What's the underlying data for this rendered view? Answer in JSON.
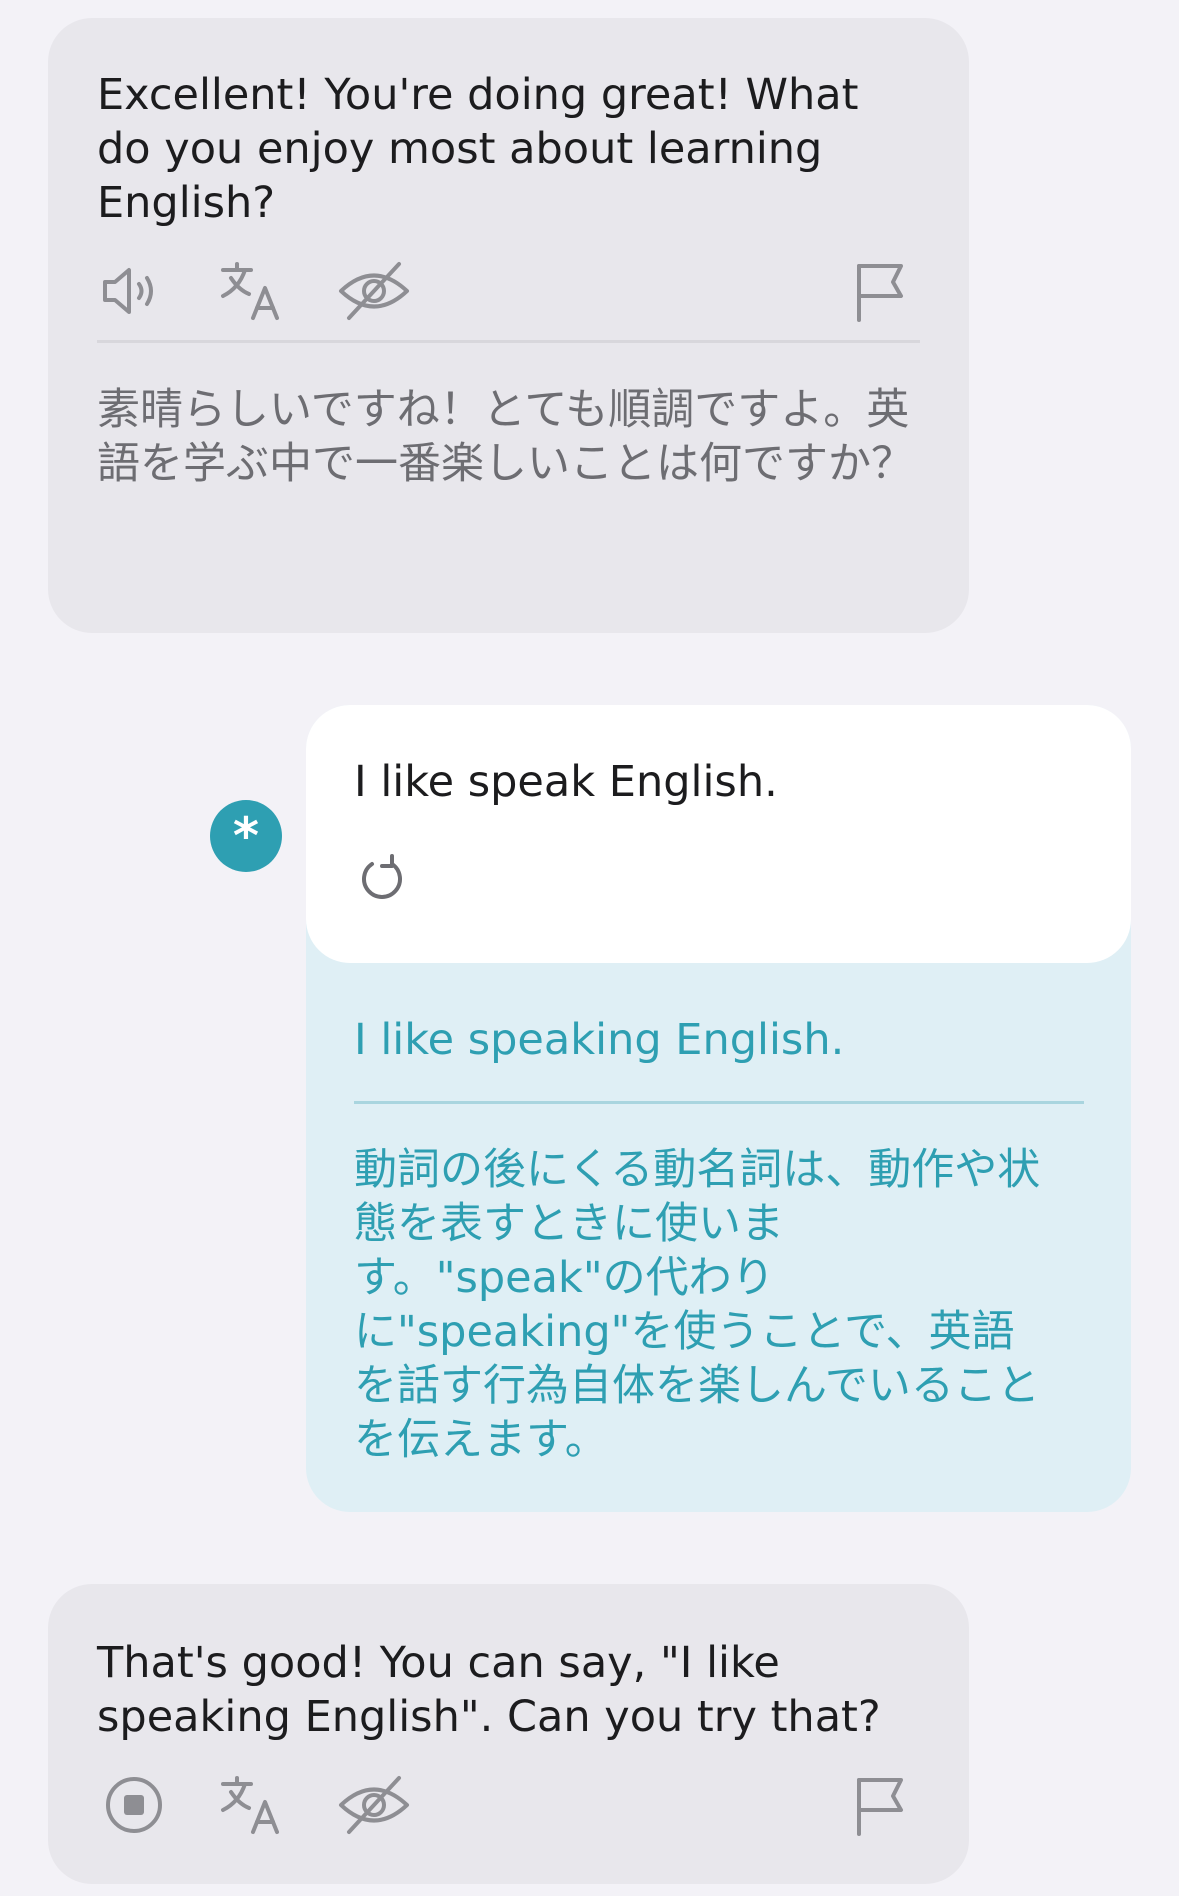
{
  "messages": {
    "ai_first": {
      "text": "Excellent! You're doing great! What do you enjoy most about learning English?",
      "translation": "素晴らしいですね！とても順調ですよ。英語を学ぶ中で一番楽しいことは何ですか？"
    },
    "user": {
      "avatar_symbol": "*",
      "text": "I like speak English.",
      "corrected_text": "I like speaking English.",
      "explanation": "動詞の後にくる動名詞は、動作や状\n態を表すときに使いま\nす。\"speak\"の代わり\nに\"speaking\"を使うことで、英語\nを話す行為自体を楽しんでいること\nを伝えます。"
    },
    "ai_second": {
      "text": "That's good! You can say, \"I like speaking English\". Can you try that?"
    }
  },
  "icons": {
    "speaker": "speaker-icon",
    "translate": "translate-icon",
    "hide": "eye-slash-icon",
    "flag": "flag-icon",
    "retry": "retry-icon",
    "stop": "stop-icon"
  },
  "colors": {
    "background": "#f3f2f7",
    "ai_bubble": "#e8e7ec",
    "user_bubble": "#ffffff",
    "correction_panel": "#dfeff5",
    "accent": "#2e9fb2",
    "icon_gray": "#8e8e93"
  }
}
